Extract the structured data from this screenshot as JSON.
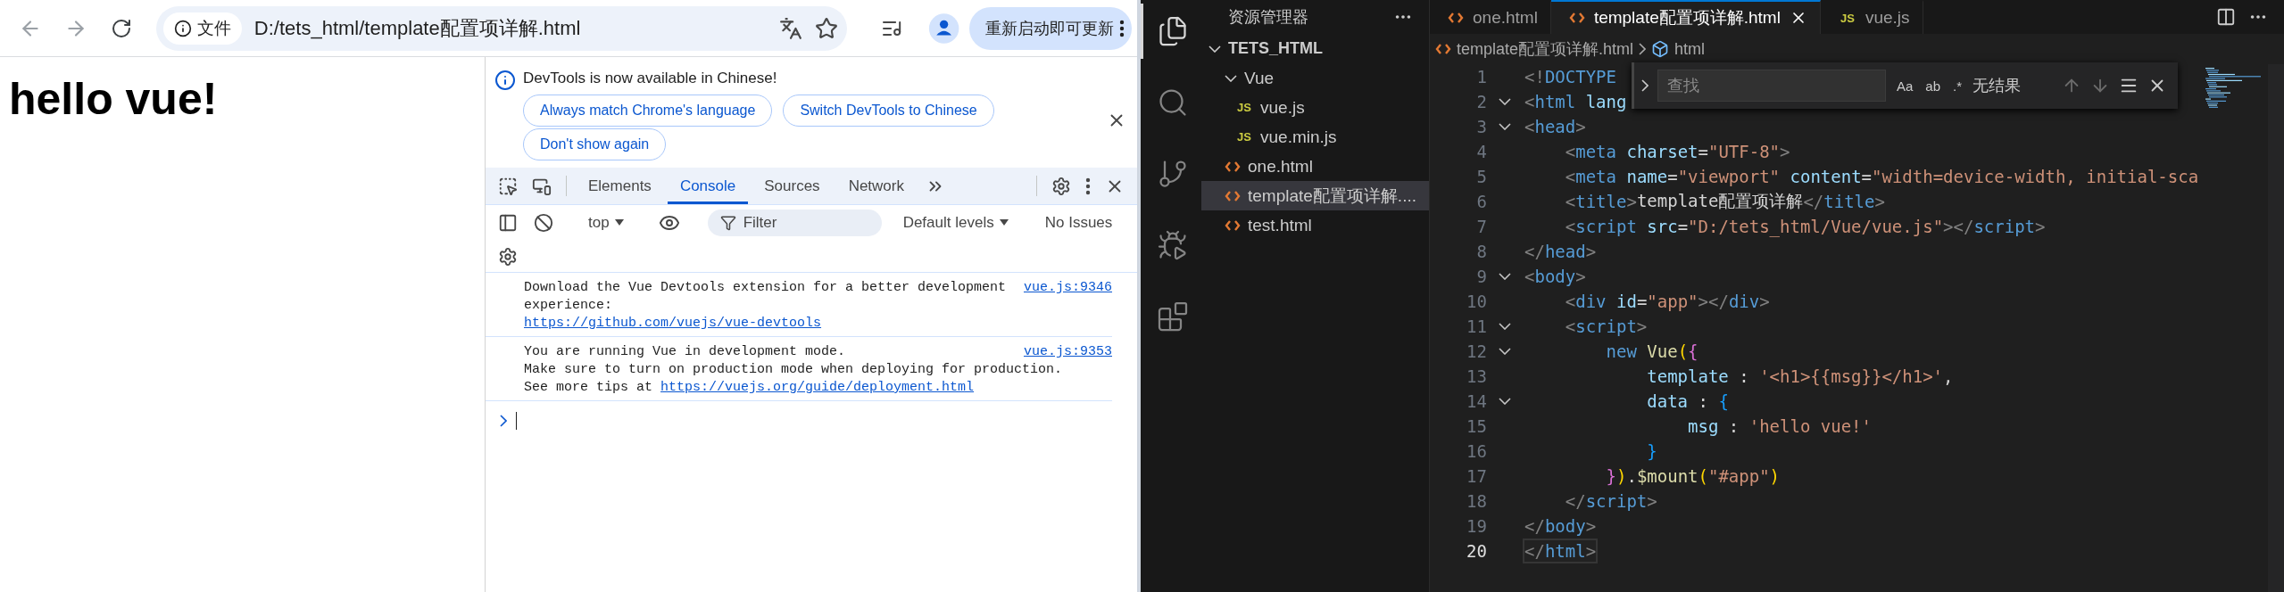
{
  "browser": {
    "toolbar": {
      "address_chip": "文件",
      "url": "D:/tets_html/template配置项详解.html",
      "update_button": "重新启动即可更新"
    },
    "page": {
      "heading": "hello vue!"
    },
    "devtools": {
      "infobar": {
        "message": "DevTools is now available in Chinese!",
        "buttons": [
          "Always match Chrome's language",
          "Switch DevTools to Chinese",
          "Don't show again"
        ]
      },
      "tabs": [
        {
          "label": "Elements",
          "selected": false
        },
        {
          "label": "Console",
          "selected": true
        },
        {
          "label": "Sources",
          "selected": false
        },
        {
          "label": "Network",
          "selected": false
        }
      ],
      "console_toolbar": {
        "context": "top",
        "filter": {
          "placeholder": "Filter"
        },
        "levels": "Default levels",
        "issues": "No Issues"
      },
      "messages": [
        {
          "source": "vue.js:9346",
          "lines": [
            {
              "text": "Download the Vue Devtools extension for a better development"
            },
            {
              "text": "experience:"
            },
            {
              "link": "https://github.com/vuejs/vue-devtools"
            }
          ]
        },
        {
          "source": "vue.js:9353",
          "lines": [
            {
              "text": "You are running Vue in development mode."
            },
            {
              "text": "Make sure to turn on production mode when deploying for production."
            },
            {
              "text": "See more tips at ",
              "link": "https://vuejs.org/guide/deployment.html"
            }
          ]
        }
      ]
    }
  },
  "code_editor": {
    "activity_bar": [
      {
        "kind": "files",
        "selected": true
      },
      {
        "kind": "search",
        "selected": false
      },
      {
        "kind": "source_control",
        "selected": false
      },
      {
        "kind": "run_debug",
        "selected": false
      },
      {
        "kind": "extensions",
        "selected": false
      }
    ],
    "explorer": {
      "title": "资源管理器",
      "section": {
        "name": "TETS_HTML",
        "expanded": true
      },
      "tree": [
        {
          "name": "Vue",
          "kind": "folder",
          "expanded": true,
          "selected": false,
          "children": [
            {
              "name": "vue.js",
              "kind": "js",
              "badge": "JS",
              "selected": false
            },
            {
              "name": "vue.min.js",
              "kind": "js",
              "badge": "JS",
              "selected": false
            }
          ]
        },
        {
          "name": "one.html",
          "kind": "html",
          "selected": false
        },
        {
          "name": "template配置项详解....",
          "kind": "html",
          "selected": true
        },
        {
          "name": "test.html",
          "kind": "html",
          "selected": false
        }
      ]
    },
    "tabs": [
      {
        "label": "one.html",
        "kind": "html",
        "selected": false
      },
      {
        "label": "template配置项详解.html",
        "kind": "html",
        "selected": true
      },
      {
        "label": "vue.js",
        "kind": "js",
        "badge": "JS",
        "selected": false
      }
    ],
    "breadcrumb": [
      {
        "label": "template配置项详解.html",
        "kind": "html"
      },
      {
        "label": "html",
        "kind": "element"
      }
    ],
    "find": {
      "placeholder": "查找",
      "options": [
        "Aa",
        "ab",
        ".*"
      ],
      "result": "无结果"
    },
    "lines": [
      {
        "number": "1",
        "foldable": false,
        "current": false,
        "code": "<!DOCTYPE"
      },
      {
        "number": "2",
        "foldable": true,
        "current": false,
        "code": "<html lang"
      },
      {
        "number": "3",
        "foldable": true,
        "current": false,
        "code": "<head>"
      },
      {
        "number": "4",
        "foldable": false,
        "current": false,
        "code": "    <meta charset=\"UTF-8\">"
      },
      {
        "number": "5",
        "foldable": false,
        "current": false,
        "code": "    <meta name=\"viewport\" content=\"width=device-width, initial-sca"
      },
      {
        "number": "6",
        "foldable": false,
        "current": false,
        "code": "    <title>template配置项详解</title>"
      },
      {
        "number": "7",
        "foldable": false,
        "current": false,
        "code": "    <script src=\"D:/tets_html/Vue/vue.js\"></script>"
      },
      {
        "number": "8",
        "foldable": false,
        "current": false,
        "code": "</head>"
      },
      {
        "number": "9",
        "foldable": true,
        "current": false,
        "code": "<body>"
      },
      {
        "number": "10",
        "foldable": false,
        "current": false,
        "code": "    <div id=\"app\"></div>"
      },
      {
        "number": "11",
        "foldable": true,
        "current": false,
        "code": "    <script>"
      },
      {
        "number": "12",
        "foldable": true,
        "current": false,
        "code": "        new Vue({"
      },
      {
        "number": "13",
        "foldable": false,
        "current": false,
        "code": "            template : '<h1>{{msg}}</h1>',"
      },
      {
        "number": "14",
        "foldable": true,
        "current": false,
        "code": "            data : {"
      },
      {
        "number": "15",
        "foldable": false,
        "current": false,
        "code": "                msg : 'hello vue!'"
      },
      {
        "number": "16",
        "foldable": false,
        "current": false,
        "code": "            }"
      },
      {
        "number": "17",
        "foldable": false,
        "current": false,
        "code": "        }).$mount(\"#app\")"
      },
      {
        "number": "18",
        "foldable": false,
        "current": false,
        "code": "    </script>"
      },
      {
        "number": "19",
        "foldable": false,
        "current": false,
        "code": "</body>"
      },
      {
        "number": "20",
        "foldable": false,
        "current": true,
        "code": "</html>"
      }
    ]
  }
}
